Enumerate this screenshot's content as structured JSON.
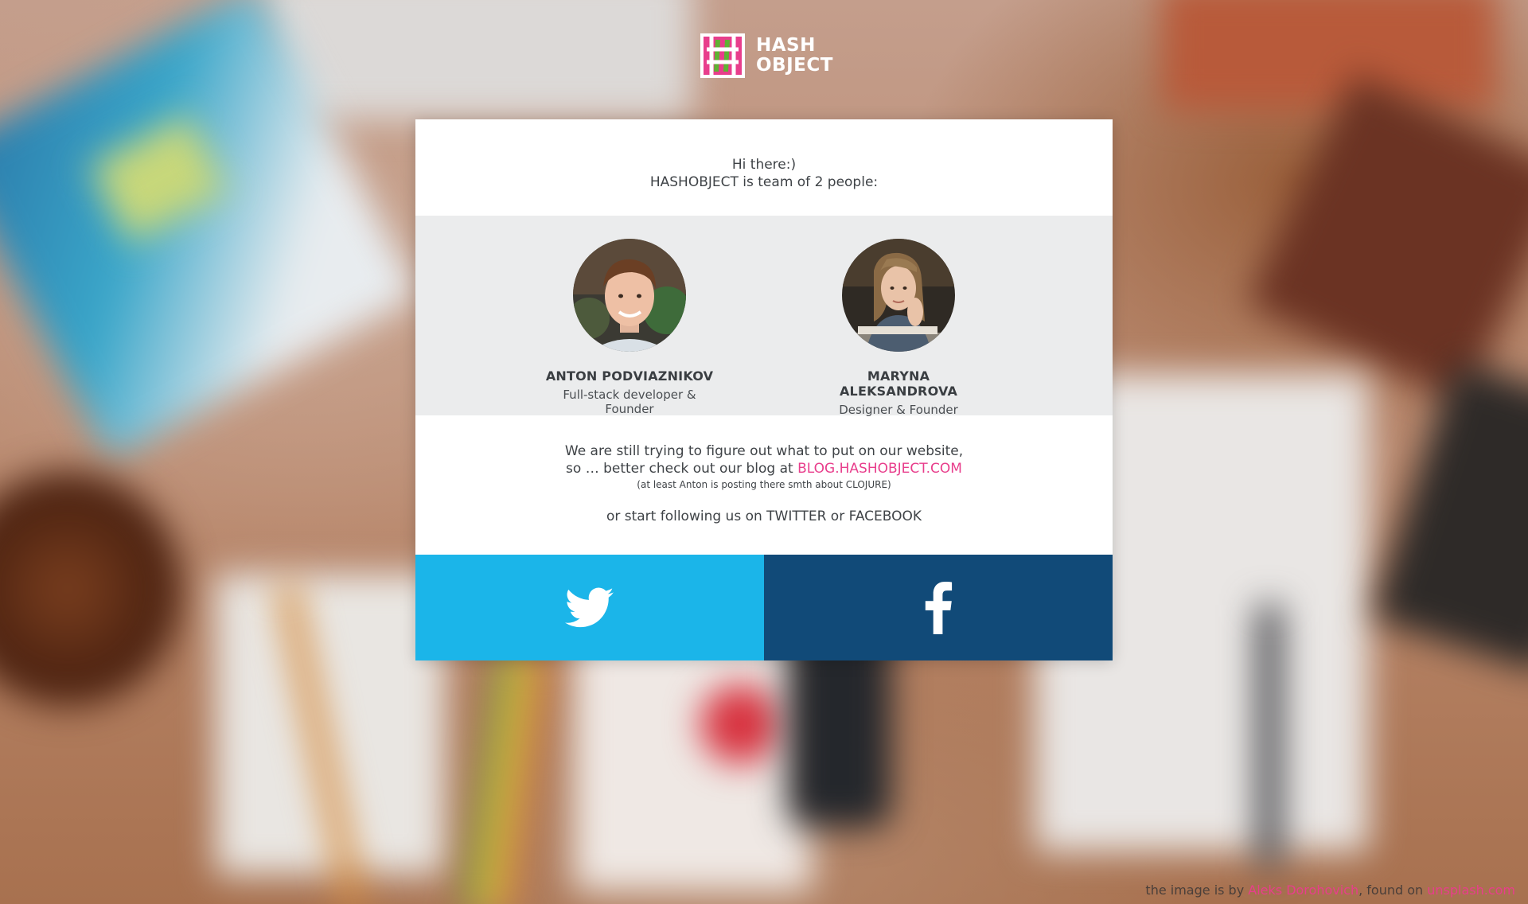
{
  "logo": {
    "line1": "HASH",
    "line2": "OBJECT",
    "mark_icon": "hash-logo-icon"
  },
  "intro": {
    "line1": "Hi there:)",
    "line2": "HASHOBJECT is team of 2 people:"
  },
  "team": [
    {
      "name": "ANTON PODVIAZNIKOV",
      "role": "Full-stack developer & Founder"
    },
    {
      "name": "MARYNA ALEKSANDROVA",
      "role": "Designer & Founder"
    }
  ],
  "info": {
    "line1": "We are still trying to figure out what to put on our website,",
    "line2_prefix": "so … better check out our blog at ",
    "blog_link": "BLOG.HASHOBJECT.COM",
    "small": "(at least Anton is posting there smth about CLOJURE)",
    "follow": "or start following us on TWITTER or FACEBOOK"
  },
  "social": {
    "twitter_icon": "twitter-icon",
    "facebook_icon": "facebook-icon"
  },
  "credit": {
    "prefix": "the image is by ",
    "author": "Aleks Dorohovich",
    "middle": ", found on ",
    "site": "unsplash.com"
  },
  "colors": {
    "accent": "#e83e8c",
    "twitter": "#1bb5e9",
    "facebook": "#114a78",
    "team_bg": "#ebeced"
  }
}
